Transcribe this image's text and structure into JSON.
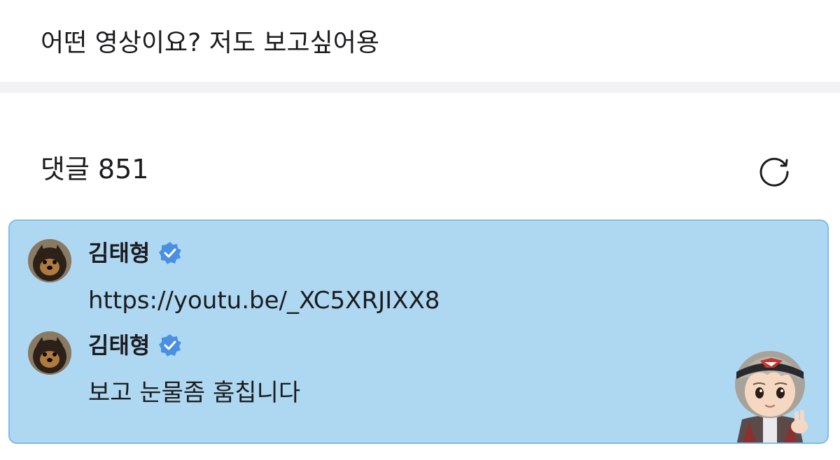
{
  "post": {
    "text": "어떤 영상이요? 저도 보고싶어용"
  },
  "comments": {
    "label": "댓글",
    "count": "851",
    "refresh_icon": "refresh-icon",
    "items": [
      {
        "author": "김태형",
        "verified": true,
        "text": "https://youtu.be/_XC5XRJIXX8"
      },
      {
        "author": "김태형",
        "verified": true,
        "text": "보고 눈물좀 훔칩니다"
      }
    ]
  },
  "colors": {
    "highlight_background": "#aed8f2",
    "highlight_border": "#7fbde6",
    "verified_badge": "#4a90e2",
    "divider": "#f2f2f5"
  }
}
